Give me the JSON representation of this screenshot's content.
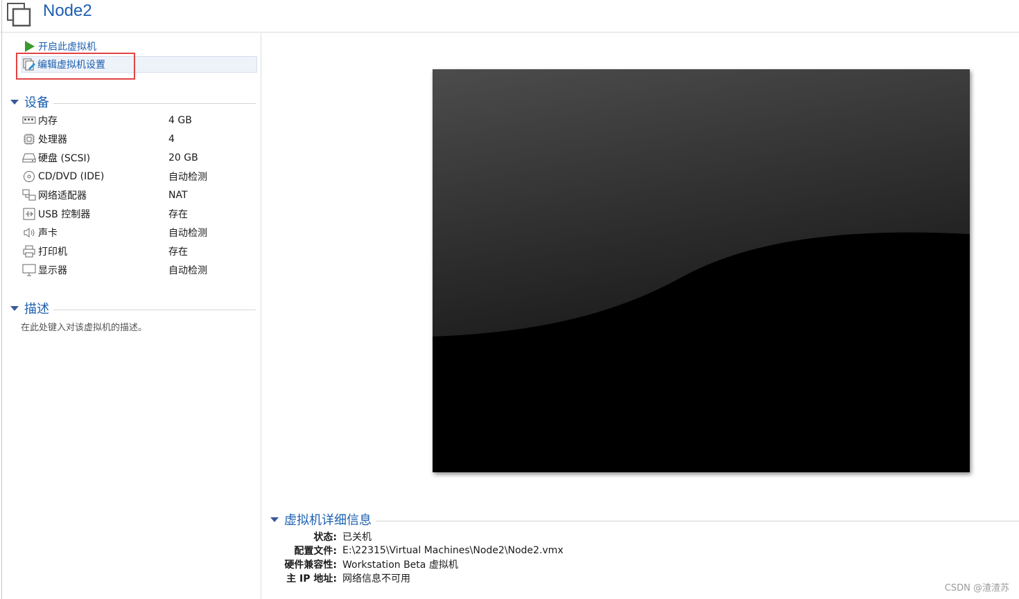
{
  "header": {
    "title": "Node2",
    "icon": "vm-window-icon"
  },
  "actions": {
    "start": {
      "label": "开启此虚拟机",
      "icon": "play-icon",
      "color": "#3a9a2a"
    },
    "edit": {
      "label": "编辑虚拟机设置",
      "icon": "edit-settings-icon"
    }
  },
  "devices": {
    "title": "设备",
    "items": [
      {
        "icon": "memory-icon",
        "name": "内存",
        "value": "4 GB"
      },
      {
        "icon": "cpu-icon",
        "name": "处理器",
        "value": "4"
      },
      {
        "icon": "harddisk-icon",
        "name": "硬盘 (SCSI)",
        "value": "20 GB"
      },
      {
        "icon": "cd-icon",
        "name": "CD/DVD (IDE)",
        "value": "自动检测"
      },
      {
        "icon": "network-icon",
        "name": "网络适配器",
        "value": "NAT"
      },
      {
        "icon": "usb-icon",
        "name": "USB 控制器",
        "value": "存在"
      },
      {
        "icon": "sound-icon",
        "name": "声卡",
        "value": "自动检测"
      },
      {
        "icon": "printer-icon",
        "name": "打印机",
        "value": "存在"
      },
      {
        "icon": "display-icon",
        "name": "显示器",
        "value": "自动检测"
      }
    ]
  },
  "description": {
    "title": "描述",
    "placeholder": "在此处键入对该虚拟机的描述。"
  },
  "details": {
    "title": "虚拟机详细信息",
    "rows": [
      {
        "label": "状态:",
        "value": "已关机"
      },
      {
        "label": "配置文件:",
        "value": "E:\\22315\\Virtual Machines\\Node2\\Node2.vmx"
      },
      {
        "label": "硬件兼容性:",
        "value": "Workstation Beta 虚拟机"
      },
      {
        "label": "主 IP 地址:",
        "value": "网络信息不可用"
      }
    ]
  },
  "watermark": "CSDN @渣渣苏",
  "colors": {
    "accent": "#1c5fb0",
    "highlight_box": "#e24343",
    "screen_bg": "#000000"
  }
}
